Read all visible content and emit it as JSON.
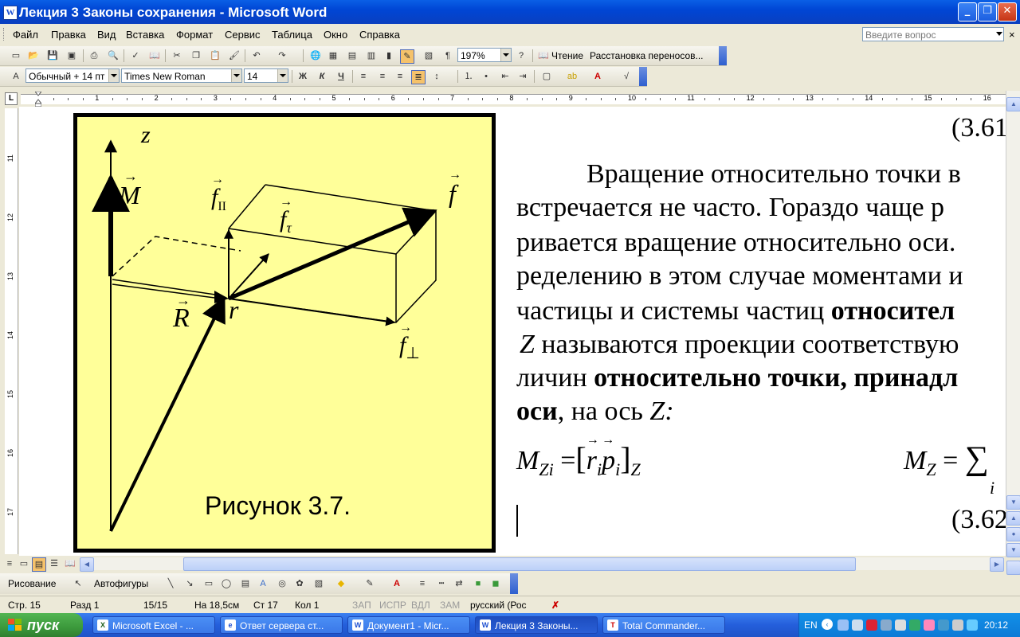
{
  "window": {
    "title": "Лекция 3 Законы сохранения - Microsoft Word",
    "title_icon": "word-doc-icon"
  },
  "menu": {
    "items": [
      "Файл",
      "Правка",
      "Вид",
      "Вставка",
      "Формат",
      "Сервис",
      "Таблица",
      "Окно",
      "Справка"
    ],
    "ask_placeholder": "Введите вопрос"
  },
  "standard_toolbar": {
    "zoom": "197%",
    "reading_label": "Чтение",
    "hyphenation_label": "Расстановка переносов..."
  },
  "formatting_toolbar": {
    "style": "Обычный + 14 пт",
    "font": "Times New Roman",
    "size": "14",
    "bold_label": "Ж",
    "italic_label": "К",
    "underline_label": "Ч"
  },
  "ruler": {
    "corner_label": "L",
    "numbers": [
      "1",
      "2",
      "3",
      "4",
      "5",
      "6",
      "7",
      "8",
      "9",
      "10",
      "11",
      "12",
      "13",
      "14",
      "15",
      "16"
    ],
    "vertical_numbers": [
      "11",
      "12",
      "13",
      "14",
      "15",
      "16",
      "17"
    ]
  },
  "figure": {
    "axis_z": "z",
    "label_M": "M",
    "label_f_parallel": "f",
    "label_f_parallel_sub": "II",
    "label_f_tau": "f",
    "label_f_tau_sub": "τ",
    "label_f": "f",
    "label_R": "R",
    "label_r": "r",
    "label_f_perp": "f",
    "label_f_perp_sub": "⊥",
    "caption": "Рисунок 3.7."
  },
  "document": {
    "eq_number_top": "(3.61",
    "lines": [
      "Вращение относительно точки в",
      "встречается не часто. Гораздо чаще р",
      "ривается вращение относительно оси.",
      "ределению в этом случае моментами и"
    ],
    "line5_normal": "частицы и системы частиц",
    "line5_bold": "относител",
    "line6_axis": "Z",
    "line6_rest": "называются проекции соответствую",
    "line7_normal": "личин",
    "line7_bold": "относительно точки, принадл",
    "line8_bold": "оси",
    "line8_rest": ", на ось",
    "line8_axis": "Z:",
    "formula_left_M": "M",
    "formula_left_sub": "Zi",
    "formula_left_eq": "=",
    "formula_left_r": "r",
    "formula_left_ri": "i",
    "formula_left_p": "p",
    "formula_left_pi": "i",
    "formula_left_Z": "Z",
    "formula_right_M": "M",
    "formula_right_sub": "Z",
    "formula_right_eq": "=",
    "formula_right_sum": "∑",
    "formula_right_i": "i",
    "eq_number_bottom": "(3.62"
  },
  "drawing_toolbar": {
    "draw_label": "Рисование",
    "autoshapes_label": "Автофигуры"
  },
  "status": {
    "page": "Стр. 15",
    "section": "Разд 1",
    "pages": "15/15",
    "position": "На 18,5см",
    "line": "Ст 17",
    "col": "Кол 1",
    "rec": "ЗАП",
    "trk": "ИСПР",
    "ext": "ВДЛ",
    "ovr": "ЗАМ",
    "language": "русский (Рос"
  },
  "taskbar": {
    "start_label": "пуск",
    "tasks": [
      {
        "label": "Microsoft Excel - ...",
        "icon": "excel-icon"
      },
      {
        "label": "Ответ сервера ст...",
        "icon": "ie-icon"
      },
      {
        "label": "Документ1 - Micr...",
        "icon": "word-icon"
      },
      {
        "label": "Лекция 3 Законы...",
        "icon": "word-icon"
      },
      {
        "label": "Total Commander...",
        "icon": "totalcmd-icon"
      }
    ],
    "lang": "EN",
    "clock": "20:12"
  },
  "colors": {
    "figure_bg": "#ffff99",
    "titlebar": "#0054e3",
    "taskbar": "#245edb",
    "start": "#3c993c"
  }
}
